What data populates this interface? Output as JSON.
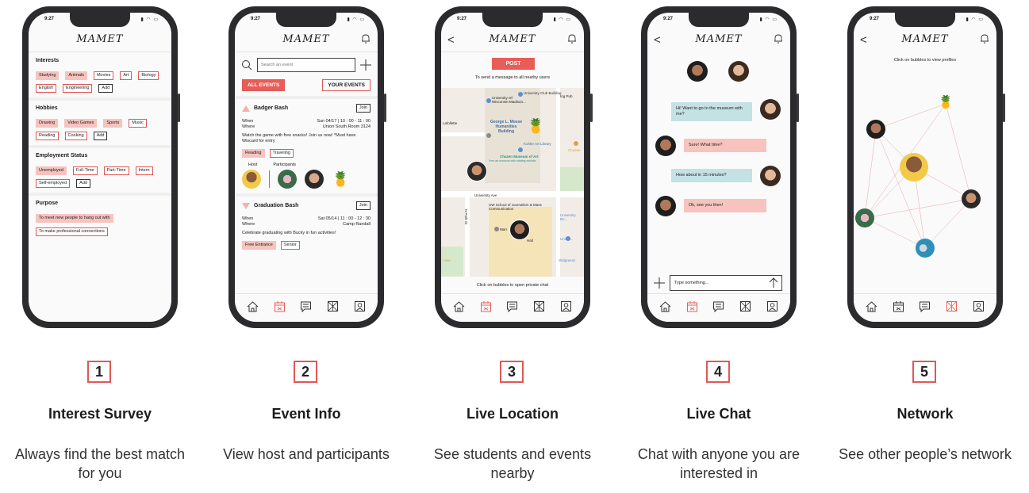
{
  "status": {
    "time": "9:27",
    "icons": "▮ ◠ ▭"
  },
  "logo": "MAMET",
  "colors": {
    "accent": "#e85d57",
    "chip_selected": "#f6c3bf",
    "chat_blue": "#c4e1e4"
  },
  "nav_icons": [
    "home-icon",
    "calendar-icon",
    "chat-icon",
    "network-icon",
    "profile-icon"
  ],
  "screens": [
    {
      "number": "1",
      "title": "Interest Survey",
      "desc": "Always find the best match for you",
      "active_nav": -1
    },
    {
      "number": "2",
      "title": "Event Info",
      "desc": "View host and participants",
      "active_nav": 1
    },
    {
      "number": "3",
      "title": "Live Location",
      "desc": "See students and events nearby",
      "active_nav": 1
    },
    {
      "number": "4",
      "title": "Live Chat",
      "desc": "Chat with anyone you are interested in",
      "active_nav": 1
    },
    {
      "number": "5",
      "title": "Network",
      "desc": "See other people’s network",
      "active_nav": 3
    }
  ],
  "survey": {
    "interests": {
      "title": "Interests",
      "chips": [
        {
          "label": "Studying",
          "sel": true
        },
        {
          "label": "Animals",
          "sel": true
        },
        {
          "label": "Movies",
          "sel": false
        },
        {
          "label": "Art",
          "sel": false
        },
        {
          "label": "Biology",
          "sel": false
        },
        {
          "label": "English",
          "sel": false
        },
        {
          "label": "Engineering",
          "sel": false
        },
        {
          "label": "Add",
          "add": true
        }
      ]
    },
    "hobbies": {
      "title": "Hobbies",
      "chips": [
        {
          "label": "Drawing",
          "sel": true
        },
        {
          "label": "Video Games",
          "sel": true
        },
        {
          "label": "Sports",
          "sel": true
        },
        {
          "label": "Music",
          "sel": false
        },
        {
          "label": "Reading",
          "sel": false
        },
        {
          "label": "Cooking",
          "sel": false
        },
        {
          "label": "Add",
          "add": true
        }
      ]
    },
    "employment": {
      "title": "Employment Status",
      "chips": [
        {
          "label": "Unemployed",
          "sel": true
        },
        {
          "label": "Full-Time",
          "sel": false
        },
        {
          "label": "Part-Time",
          "sel": false
        },
        {
          "label": "Intern",
          "sel": false
        },
        {
          "label": "Self-employed",
          "sel": false
        },
        {
          "label": "Add",
          "add": true
        }
      ]
    },
    "purpose": {
      "title": "Purpose",
      "chips": [
        {
          "label": "To meet new people to hang out with",
          "sel": true
        },
        {
          "label": "To make professional connections",
          "sel": false
        }
      ]
    }
  },
  "events": {
    "search_placeholder": "Search an event",
    "tab_all": "ALL EVENTS",
    "tab_yours": "YOUR EVENTS",
    "list": [
      {
        "title": "Badger Bash",
        "join": "Join",
        "when_label": "When",
        "when": "Sun 04/17 | 10 : 00 - 11 : 00",
        "where_label": "Where",
        "where": "Union South Room 3124",
        "desc": "Watch the game with free snacks! Join us now! *Must have Wiscard for entry",
        "tags": [
          "Reading",
          "Traveling"
        ],
        "host_label": "Host",
        "participants_label": "Participants"
      },
      {
        "title": "Graduation Bash",
        "join": "Join",
        "when_label": "When",
        "when": "Sat 05/14 | 11 : 00 - 12 : 30",
        "where_label": "Where",
        "where": "Camp Randall",
        "desc": "Celebrate graduating with Bucky in fun activities!",
        "tags": [
          "Free Entrance",
          "Senior"
        ]
      }
    ]
  },
  "map": {
    "post": "POST",
    "subtitle": "To send a message to all nearby users",
    "hint": "Click on bubbles to open private chat",
    "labels": [
      "University Of Wisconsin-Madison...",
      "University Club Building",
      "George L. Mosse Humanities Building",
      "Kohler Art Library",
      "Chazen Museum of Art",
      "Free art museum with rotating exhibits",
      "University Ave",
      "UW School of Journalism & Mass Communication",
      "N Park St",
      "Hall",
      "Walgreens",
      "Chazen",
      "Lafollette",
      "Lake",
      "Univer...",
      "Ing Pub",
      "Marr",
      "University Bo..."
    ]
  },
  "chat": {
    "messages": [
      {
        "text": "Hi! Want to go to the museum with me?",
        "side": "right"
      },
      {
        "text": "Sure! What time?",
        "side": "left"
      },
      {
        "text": "How about in 15 minutes?",
        "side": "right"
      },
      {
        "text": "Ok, see you then!",
        "side": "left"
      }
    ],
    "input_placeholder": "Type something..."
  },
  "network": {
    "hint": "Click on bubbles to view profiles"
  }
}
